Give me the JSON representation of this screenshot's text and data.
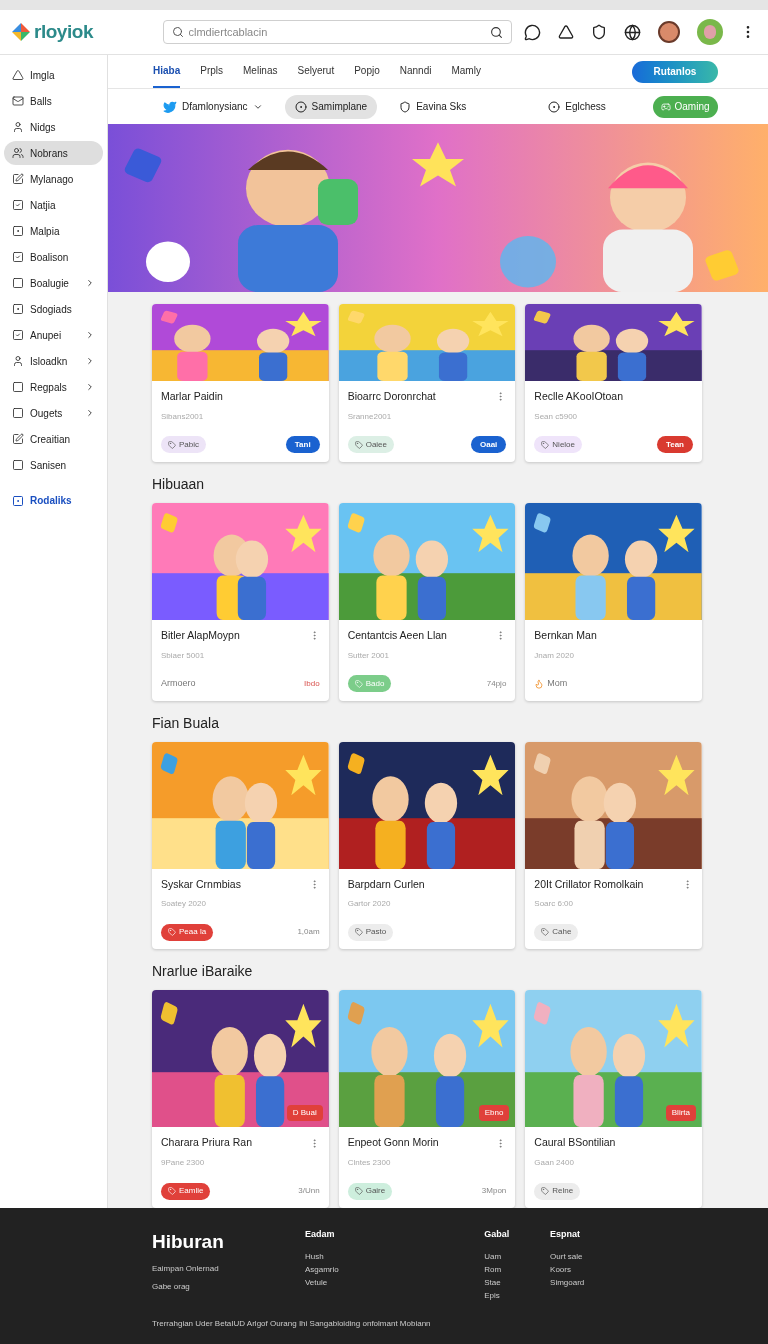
{
  "header": {
    "logo": "rloyiok",
    "search": {
      "placeholder": "clmdiertcablacin"
    }
  },
  "sidebar": {
    "items": [
      {
        "label": "Imgla",
        "selected": false,
        "expandable": false
      },
      {
        "label": "Balls",
        "selected": false,
        "expandable": false
      },
      {
        "label": "Nidgs",
        "selected": false,
        "expandable": false
      },
      {
        "label": "Nobrans",
        "selected": true,
        "expandable": false
      },
      {
        "label": "Mylanago",
        "selected": false,
        "expandable": false
      },
      {
        "label": "Natjia",
        "selected": false,
        "expandable": false
      },
      {
        "label": "Malpia",
        "selected": false,
        "expandable": false
      },
      {
        "label": "Boalison",
        "selected": false,
        "expandable": false
      },
      {
        "label": "Boalugie",
        "selected": false,
        "expandable": true
      },
      {
        "label": "Sdogiads",
        "selected": false,
        "expandable": false
      },
      {
        "label": "Anupei",
        "selected": false,
        "expandable": true
      },
      {
        "label": "Isloadkn",
        "selected": false,
        "expandable": true
      },
      {
        "label": "Regpals",
        "selected": false,
        "expandable": true
      },
      {
        "label": "Ougets",
        "selected": false,
        "expandable": true
      },
      {
        "label": "Creaitian",
        "selected": false,
        "expandable": false
      },
      {
        "label": "Sanisen",
        "selected": false,
        "expandable": false
      }
    ],
    "footer_link": "Rodaliks"
  },
  "tabs": [
    {
      "label": "Hiaba",
      "selected": true
    },
    {
      "label": "Prpls",
      "selected": false
    },
    {
      "label": "Melinas",
      "selected": false
    },
    {
      "label": "Selyerut",
      "selected": false
    },
    {
      "label": "Popjo",
      "selected": false
    },
    {
      "label": "Nanndi",
      "selected": false
    },
    {
      "label": "Mamly",
      "selected": false
    }
  ],
  "tabs_button": "Rutanlos",
  "filters": [
    {
      "label": "Dfamlonysianc",
      "kind": "dropdown",
      "selected": false
    },
    {
      "label": "Samimplane",
      "kind": "pill",
      "selected": true
    },
    {
      "label": "Eavina Sks",
      "kind": "pill",
      "selected": false
    },
    {
      "label": "Eglchess",
      "kind": "pill",
      "selected": false
    }
  ],
  "filter_button": "Oaming",
  "sections": [
    {
      "cards": [
        {
          "title": "Marlar Paidin",
          "meta": "Sibans2001",
          "menu": false,
          "tag": {
            "label": "Pabic",
            "kind": "soft",
            "color": "#ede4f7"
          },
          "action": {
            "kind": "button",
            "label": "Tani",
            "color": "#1a62d0"
          }
        },
        {
          "title": "Bioarrc Doronrchat",
          "meta": "Sranne2001",
          "menu": true,
          "tag": {
            "label": "Oaiee",
            "kind": "soft",
            "color": "#dcefe5"
          },
          "action": {
            "kind": "button",
            "label": "Oaai",
            "color": "#1a62d0"
          }
        },
        {
          "title": "Reclle AKooIOtoan",
          "meta": "Sean c5900",
          "menu": false,
          "tag": {
            "label": "Nieloe",
            "kind": "soft",
            "color": "#efe4fa"
          },
          "action": {
            "kind": "button",
            "label": "Tean",
            "color": "#d93a30"
          }
        }
      ]
    },
    {
      "heading": "Hibuaan",
      "cards": [
        {
          "title": "Bitler AlapMoypn",
          "meta": "Sbiaer 5001",
          "menu": true,
          "tag": {
            "label": "Armoero",
            "kind": "plain"
          },
          "action": {
            "kind": "warning",
            "label": "Ibdo"
          }
        },
        {
          "title": "Centantcis Aeen Llan",
          "meta": "Sutter 2001",
          "menu": true,
          "tag": {
            "label": "Bado",
            "kind": "solid",
            "color": "#7ccd8a"
          },
          "action": {
            "kind": "text",
            "label": "74pjo"
          }
        },
        {
          "title": "Bernkan Man",
          "meta": "Jnam 2020",
          "menu": false,
          "tag": {
            "label": "Mom",
            "kind": "plain"
          }
        }
      ]
    },
    {
      "heading": "Fian Buala",
      "cards": [
        {
          "title": "Syskar Crnmbias",
          "meta": "Soatey 2020",
          "menu": true,
          "tag": {
            "label": "Peaa la",
            "kind": "solid",
            "color": "#e0403a"
          },
          "action": {
            "kind": "text",
            "label": "1,0am"
          }
        },
        {
          "title": "Barpdarn Curlen",
          "meta": "Gartor 2020",
          "menu": false,
          "tag": {
            "label": "Pasto",
            "kind": "soft",
            "color": "#ececec"
          }
        },
        {
          "title": "20It Crillator Romolkain",
          "meta": "Soarc 6:00",
          "menu": true,
          "tag": {
            "label": "Cahe",
            "kind": "soft",
            "color": "#ececec"
          }
        }
      ]
    },
    {
      "heading": "Nrarlue iBaraike",
      "cards": [
        {
          "title": "Charara Priura Ran",
          "meta": "9Pane 2300",
          "menu": true,
          "overlay": "D Buai",
          "tag": {
            "label": "Eamlie",
            "kind": "solid",
            "color": "#e0403a"
          },
          "action": {
            "kind": "text",
            "label": "3/Unn"
          }
        },
        {
          "title": "Enpeot Gonn Morin",
          "meta": "Clntes 2300",
          "menu": true,
          "overlay": "Ebno",
          "tag": {
            "label": "Gaire",
            "kind": "soft",
            "color": "#cdeedd"
          },
          "action": {
            "kind": "text",
            "label": "3Mpon"
          }
        },
        {
          "title": "Caural BSontilian",
          "meta": "Gaan 2400",
          "menu": false,
          "overlay": "Blirta",
          "tag": {
            "label": "Relne",
            "kind": "soft",
            "color": "#ececec"
          }
        }
      ]
    }
  ],
  "footer": {
    "brand": "Hiburan",
    "brand_lines": [
      "Eaimpan Onlernad",
      "Gabe orag"
    ],
    "columns": [
      {
        "heading": "Eadam",
        "links": [
          "Hush",
          "Asgamrio",
          "Vetule"
        ]
      },
      {
        "heading": "Gabal",
        "links": [
          "Uam",
          "Rom",
          "Stae",
          "Epis"
        ]
      },
      {
        "heading": "Espnat",
        "links": [
          "Ourt sale",
          "Koors",
          "Simgoard"
        ]
      }
    ],
    "legal": "Trerrahgian Uder BetaIUD Arlgof Ourang Ihi Sangabloiding onfolmant Mobiann"
  }
}
